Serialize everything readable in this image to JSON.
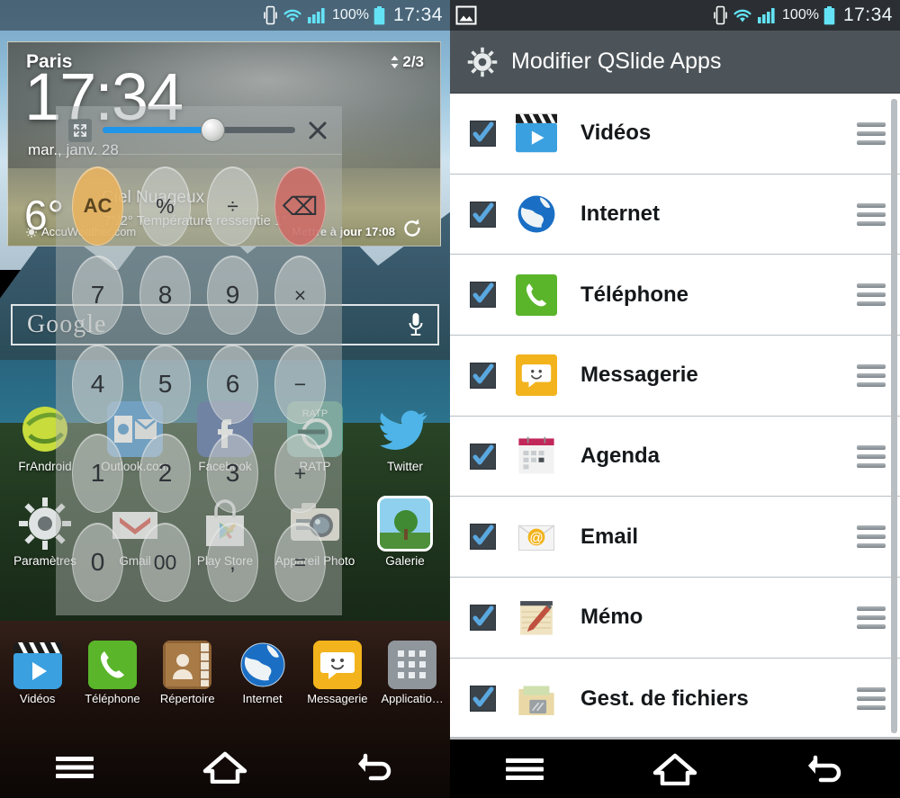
{
  "left": {
    "statusbar": {
      "battery_pct": "100%",
      "time": "17:34",
      "icons": [
        "vibrate-icon",
        "wifi-icon",
        "signal-icon",
        "battery-icon"
      ]
    },
    "weather_widget": {
      "city": "Paris",
      "pager": "2/3",
      "clock": "17:34",
      "date": "mar., janv. 28",
      "temperature": "6°",
      "condition": "Ciel Nuageux",
      "high_low_feels": "7°/2°  Température ressentie 1°",
      "source": "AccuWeather.com",
      "updated": "Mettre à jour 17:08",
      "refresh_icon": "refresh-icon"
    },
    "search": {
      "brand": "Google",
      "mic_icon": "microphone-icon"
    },
    "qslide": {
      "expand_icon": "expand-icon",
      "close_icon": "close-icon",
      "slider_value": 57,
      "keys": [
        {
          "label": "AC",
          "style": "ac"
        },
        {
          "label": "%",
          "style": "sm"
        },
        {
          "label": "÷",
          "style": "sm"
        },
        {
          "label": "⌫",
          "style": "del"
        },
        {
          "label": "7",
          "style": ""
        },
        {
          "label": "8",
          "style": ""
        },
        {
          "label": "9",
          "style": ""
        },
        {
          "label": "×",
          "style": "sm"
        },
        {
          "label": "4",
          "style": ""
        },
        {
          "label": "5",
          "style": ""
        },
        {
          "label": "6",
          "style": ""
        },
        {
          "label": "−",
          "style": "sm"
        },
        {
          "label": "1",
          "style": ""
        },
        {
          "label": "2",
          "style": ""
        },
        {
          "label": "3",
          "style": ""
        },
        {
          "label": "+",
          "style": "sm"
        },
        {
          "label": "0",
          "style": ""
        },
        {
          "label": "00",
          "style": "sm"
        },
        {
          "label": ",",
          "style": "sm"
        },
        {
          "label": "=",
          "style": "sm"
        }
      ]
    },
    "home_icons_row1": [
      {
        "label": "FrAndroid",
        "icon": "frandroid-icon"
      },
      {
        "label": "Outlook.com",
        "icon": "outlook-icon"
      },
      {
        "label": "Facebook",
        "icon": "facebook-icon"
      },
      {
        "label": "RATP",
        "icon": "ratp-icon"
      },
      {
        "label": "Twitter",
        "icon": "twitter-icon"
      }
    ],
    "home_icons_row2": [
      {
        "label": "Paramètres",
        "icon": "settings-gear-icon"
      },
      {
        "label": "Gmail",
        "icon": "gmail-icon"
      },
      {
        "label": "Play Store",
        "icon": "play-store-icon"
      },
      {
        "label": "Appareil Photo",
        "icon": "camera-icon"
      },
      {
        "label": "Galerie",
        "icon": "gallery-icon"
      }
    ],
    "dock": [
      {
        "label": "Vidéos",
        "icon": "videos-icon"
      },
      {
        "label": "Téléphone",
        "icon": "phone-icon"
      },
      {
        "label": "Répertoire",
        "icon": "contacts-icon"
      },
      {
        "label": "Internet",
        "icon": "browser-globe-icon"
      },
      {
        "label": "Messagerie",
        "icon": "messaging-icon"
      },
      {
        "label": "Applicatio…",
        "icon": "app-drawer-icon"
      }
    ],
    "navbar": [
      {
        "name": "menu-button",
        "icon": "hamburger-icon"
      },
      {
        "name": "home-button",
        "icon": "home-icon"
      },
      {
        "name": "back-button",
        "icon": "back-arrow-icon"
      }
    ]
  },
  "right": {
    "statusbar": {
      "notification_icon": "screenshot-image-icon",
      "battery_pct": "100%",
      "time": "17:34",
      "icons": [
        "vibrate-icon",
        "wifi-icon",
        "signal-icon",
        "battery-icon"
      ]
    },
    "header": {
      "icon": "settings-gear-icon",
      "title": "Modifier QSlide Apps"
    },
    "apps": [
      {
        "name": "Vidéos",
        "icon": "videos-icon",
        "checked": true,
        "drag": "drag-handle-icon"
      },
      {
        "name": "Internet",
        "icon": "globe-icon",
        "checked": true,
        "drag": "drag-handle-icon"
      },
      {
        "name": "Téléphone",
        "icon": "phone-icon",
        "checked": true,
        "drag": "drag-handle-icon"
      },
      {
        "name": "Messagerie",
        "icon": "messaging-icon",
        "checked": true,
        "drag": "drag-handle-icon"
      },
      {
        "name": "Agenda",
        "icon": "calendar-icon",
        "checked": true,
        "drag": "drag-handle-icon"
      },
      {
        "name": "Email",
        "icon": "email-icon",
        "checked": true,
        "drag": "drag-handle-icon"
      },
      {
        "name": "Mémo",
        "icon": "memo-icon",
        "checked": true,
        "drag": "drag-handle-icon"
      },
      {
        "name": "Gest. de fichiers",
        "icon": "file-manager-icon",
        "checked": true,
        "drag": "drag-handle-icon"
      }
    ],
    "navbar": [
      {
        "name": "menu-button",
        "icon": "hamburger-icon"
      },
      {
        "name": "home-button",
        "icon": "home-icon"
      },
      {
        "name": "back-button",
        "icon": "back-arrow-icon"
      }
    ]
  },
  "colors": {
    "accent_blue": "#2196e8",
    "status_cyan": "#63e3f5",
    "header_gray": "#4d5459",
    "statusbar_dark": "#2b2f33",
    "ac_orange": "#e9b35d",
    "del_red": "#ce6864"
  }
}
